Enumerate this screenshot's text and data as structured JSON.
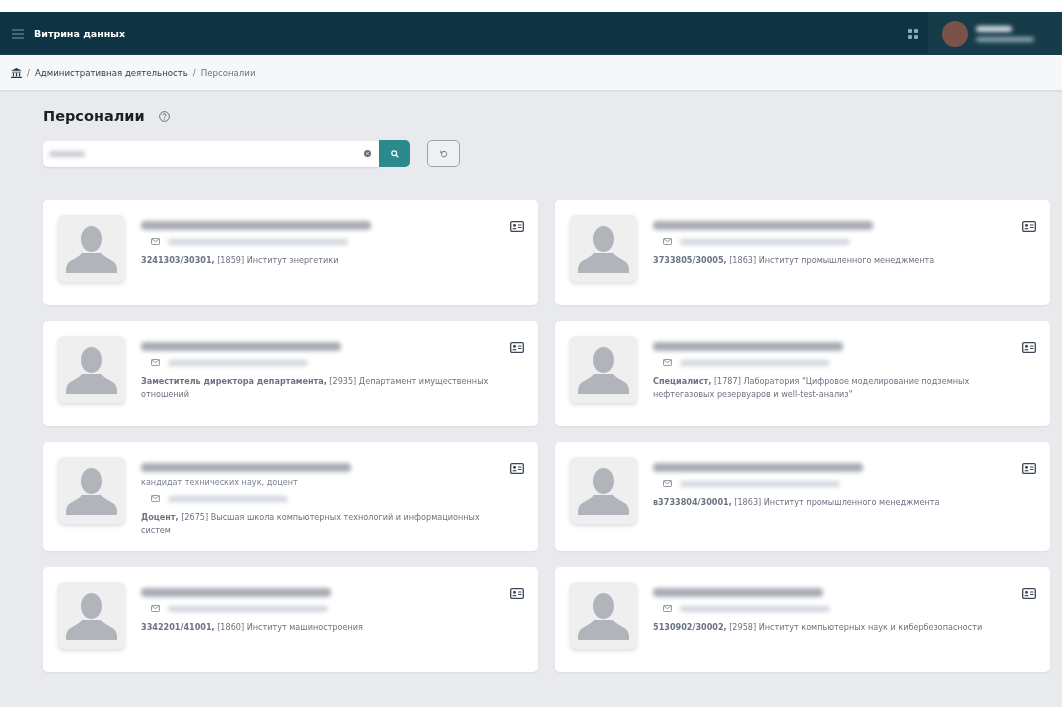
{
  "header": {
    "title": "Витрина данных"
  },
  "breadcrumbs": [
    {
      "separator": "/",
      "label": "Административная деятельность",
      "current": false
    },
    {
      "separator": "/",
      "label": "Персоналии",
      "current": true
    }
  ],
  "page": {
    "title": "Персоналии"
  },
  "people": [
    {
      "description": "**3241303/30301,** [1859] Институт энергетики"
    },
    {
      "description": "**3733805/30005,** [1863] Институт промышленного менеджмента"
    },
    {
      "description": "**Заместитель директора департамента,** [2935] Департамент имущественных отношений"
    },
    {
      "description": "**Специалист,** [1787] Лаборатория \"Цифровое моделирование подземных нефтегазовых резервуаров и well-test-анализ\""
    },
    {
      "degree": "кандидат технических наук, доцент",
      "description": "**Доцент,** [2675] Высшая школа компьютерных технологий и информационных систем"
    },
    {
      "description": "**в3733804/30001,** [1863] Институт промышленного менеджмента"
    },
    {
      "description": "**3342201/41001,** [1860] Институт машиностроения"
    },
    {
      "description": "**5130902/30002,** [2958] Институт компьютерных наук и кибербезопасности"
    }
  ]
}
